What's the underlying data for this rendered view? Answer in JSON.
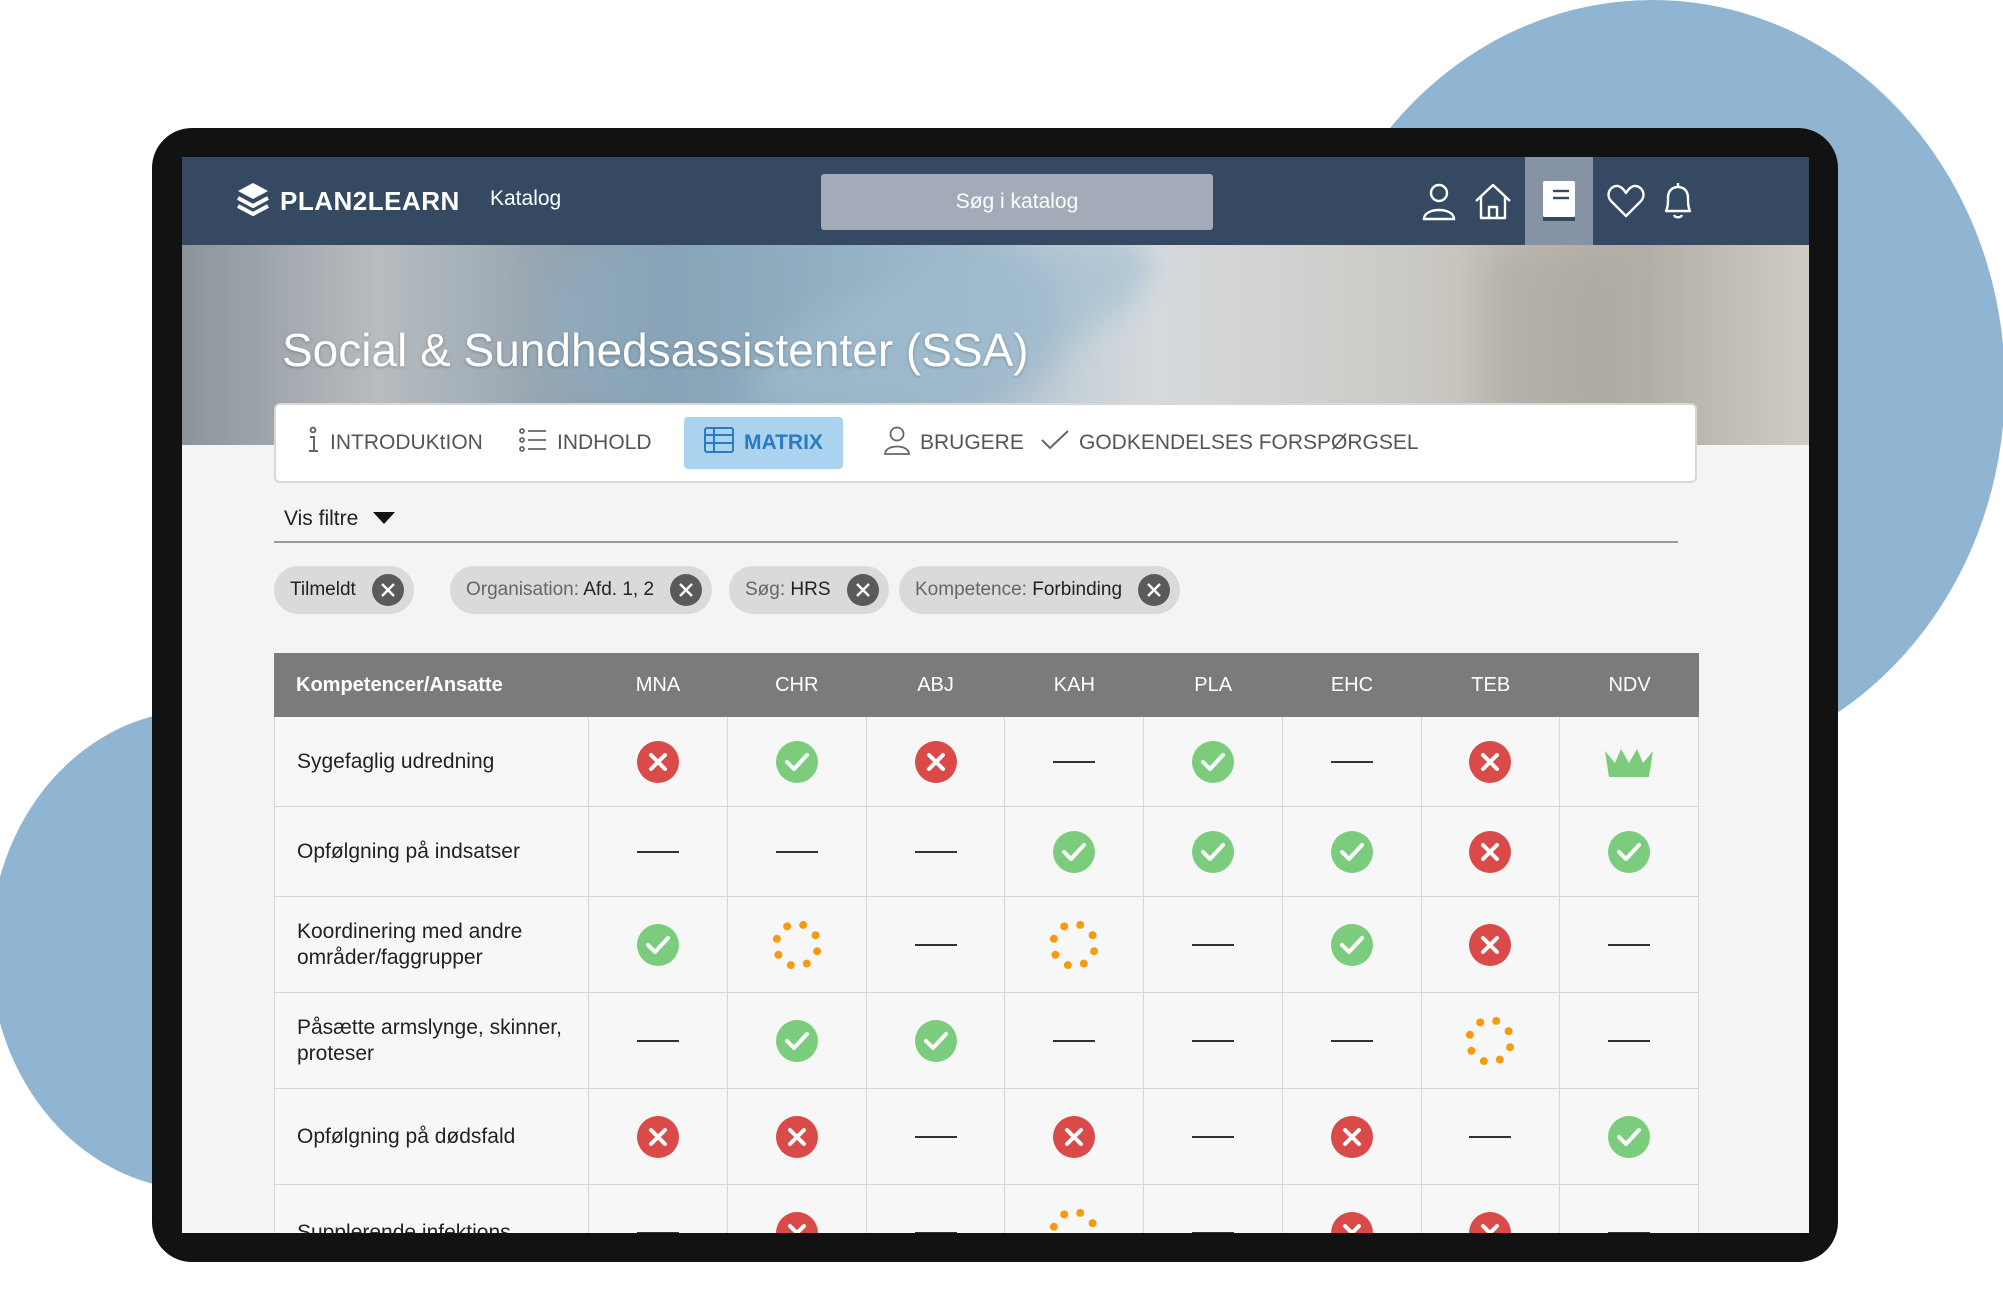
{
  "colors": {
    "accent_blue": "#2a7bc0",
    "topbar": "#354a62",
    "ok_green": "#7ccc7e",
    "fail_red": "#d94a48",
    "progress_orange": "#f39c12"
  },
  "app": {
    "logo_text": "PLAN2LEARN",
    "nav_katalog": "Katalog",
    "search_label": "Søg i katalog"
  },
  "nav_icons": [
    "user-icon",
    "home-icon",
    "catalog-book-icon",
    "heart-icon",
    "bell-icon"
  ],
  "hero": {
    "title": "Social & Sundhedsassistenter (SSA)"
  },
  "tabs": [
    {
      "label": "INTRODUKtION",
      "icon": "info-icon"
    },
    {
      "label": "INDHOLD",
      "icon": "list-icon"
    },
    {
      "label": "MATRIX",
      "icon": "table-icon",
      "active": true
    },
    {
      "label": "BRUGERE",
      "icon": "user-icon"
    },
    {
      "label": "GODKENDELSES FORSPØRGSEL",
      "icon": "checkmark-icon"
    }
  ],
  "filters": {
    "toggle_label": "Vis filtre",
    "chips": [
      {
        "label": "",
        "value": "Tilmeldt"
      },
      {
        "label": "Organisation:",
        "value": "Afd. 1, 2"
      },
      {
        "label": "Søg:",
        "value": "HRS"
      },
      {
        "label": "Kompetence:",
        "value": "Forbinding"
      }
    ]
  },
  "matrix": {
    "header": "Kompetencer/Ansatte",
    "employees": [
      "MNA",
      "CHR",
      "ABJ",
      "KAH",
      "PLA",
      "EHC",
      "TEB",
      "NDV"
    ],
    "rows": [
      {
        "name": "Sygefaglig udredning",
        "status": [
          "fail",
          "ok",
          "fail",
          "none",
          "ok",
          "none",
          "fail",
          "crown"
        ]
      },
      {
        "name": "Opfølgning på indsatser",
        "status": [
          "none",
          "none",
          "none",
          "ok",
          "ok",
          "ok",
          "fail",
          "ok"
        ]
      },
      {
        "name": "Koordinering med andre områder/faggrupper",
        "status": [
          "ok",
          "progress",
          "none",
          "progress",
          "none",
          "ok",
          "fail",
          "none"
        ]
      },
      {
        "name": "Påsætte armslynge, skinner, proteser",
        "status": [
          "none",
          "ok",
          "ok",
          "none",
          "none",
          "none",
          "progress",
          "none"
        ]
      },
      {
        "name": "Opfølgning på dødsfald",
        "status": [
          "fail",
          "fail",
          "none",
          "fail",
          "none",
          "fail",
          "none",
          "ok"
        ]
      },
      {
        "name": "Supplerende infektions",
        "status": [
          "none",
          "fail",
          "none",
          "progress",
          "none",
          "fail",
          "fail",
          "none"
        ]
      }
    ]
  }
}
